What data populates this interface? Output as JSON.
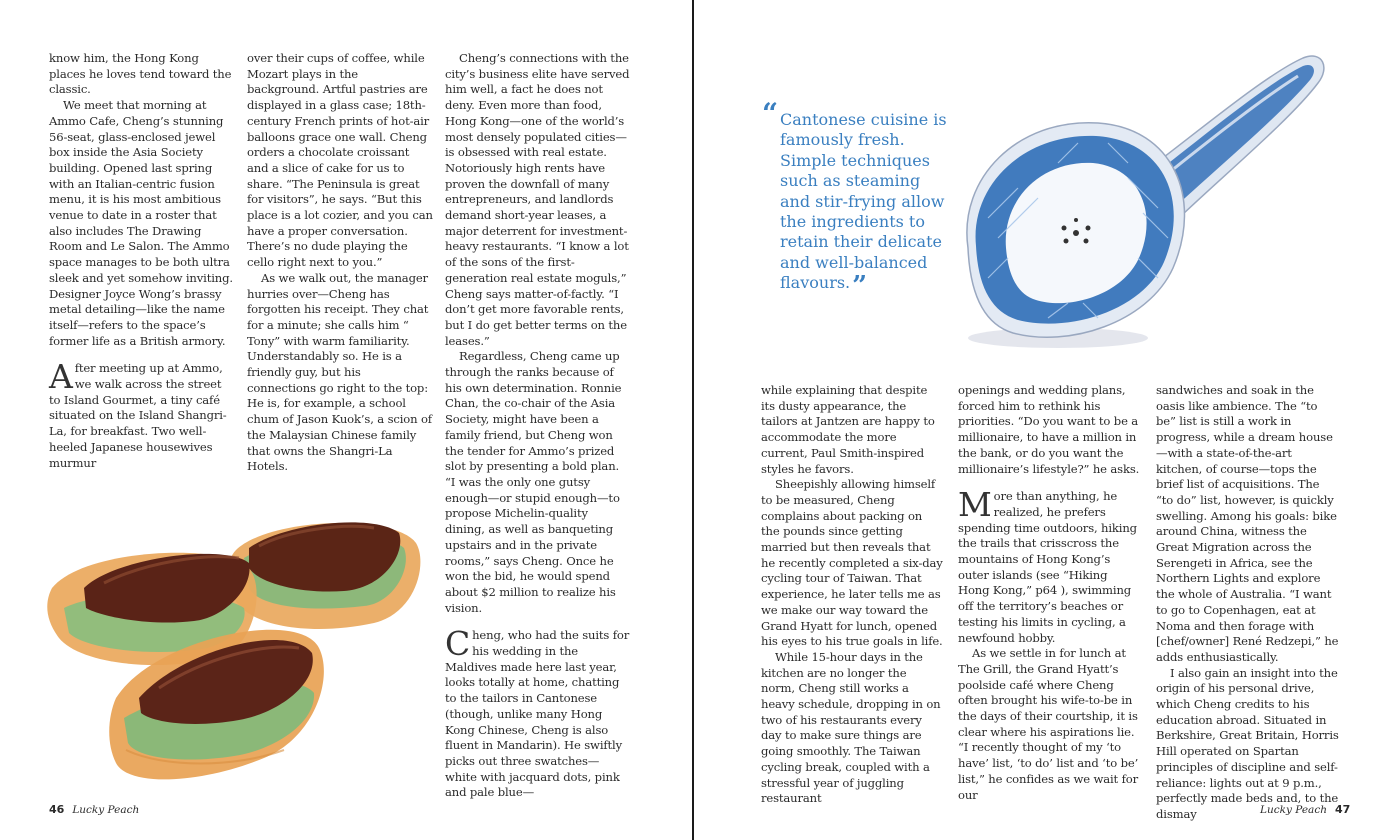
{
  "left_page": {
    "col1": {
      "p1": "know him, the Hong Kong places he loves tend toward the classic.",
      "p2": "We meet that morning at Ammo Cafe, Cheng’s stunning 56-seat, glass-enclosed jewel box inside the Asia Society building. Opened last spring with an Italian-centric fusion menu, it is his most ambitious venue to date in a roster that also includes The Drawing Room and Le Salon. The Ammo space manages to be both ultra sleek and yet somehow inviting. Designer Joyce Wong’s brassy metal detailing—like the name itself—refers to the space’s former life as a British armory.",
      "p3_drop": "A",
      "p3": "fter meeting up at Ammo, we walk across the street to Island Gourmet, a tiny café situated on the Island Shangri-La, for breakfast. Two well-heeled Japanese housewives murmur"
    },
    "col2": {
      "p1": "over their cups of coffee, while Mozart plays in the background. Artful pastries are displayed in a glass case; 18th-century French prints of hot-air balloons grace one wall. Cheng orders a chocolate croissant and a slice of cake for us to share. “The Peninsula is great for visitors”, he says. “But this place is a lot cozier, and you can have a proper conversation. There’s no dude playing the cello right next to you.”",
      "p2": "As we walk out, the manager hurries over—Cheng has forgotten his receipt. They chat for a minute; she calls him “ Tony” with warm familiarity. Understandably so. He is a friendly guy, but his connections go right to the top: He is, for example, a school chum of Jason Kuok’s, a scion of the Malaysian Chinese family that owns the Shangri-La Hotels."
    },
    "col3": {
      "p1": "Cheng’s connections with the city’s business elite have served him well, a fact he does not deny. Even more than food, Hong Kong—one of the world’s most densely populated cities—is obsessed with real estate. Notoriously high rents have proven the downfall of many entrepreneurs, and landlords demand short-year leases, a major deterrent for investment-heavy restaurants. “I know a lot of the sons of the first-generation real estate moguls,” Cheng says matter-of-factly. “I don’t get more favorable rents, but I do get better terms on the leases.”",
      "p2": "Regardless, Cheng came up through the ranks because of his own determination. Ronnie Chan, the co-chair of the Asia Society, might have been a family friend, but Cheng won the tender for Ammo’s prized slot by presenting a bold plan. “I was the only one gutsy enough—or stupid enough—to propose Michelin-quality dining, as well as banqueting upstairs and in the private rooms,” says Cheng. Once he won the bid, he would spend about $2 million to realize his vision.",
      "p3_drop": "C",
      "p3": "heng, who had the suits for his wedding in the Maldives made here last year, looks totally at home, chatting to the tailors in Cantonese (though, unlike many Hong Kong Chinese, Cheng is also fluent in Mandarin). He swiftly picks out three swatches—white with jacquard dots, pink and pale blue—"
    },
    "folio": {
      "number": "46",
      "magazine": "Lucky Peach"
    }
  },
  "right_page": {
    "pull_quote": {
      "open_mark": "“",
      "text": "Cantonese cuisine is famously fresh. Simple techniques such as steaming and stir-frying allow the ingredients to retain their delicate and well-balanced flavours.",
      "close_mark": "”"
    },
    "col1": {
      "p1": "while explaining that despite its dusty appearance, the tailors at Jantzen are happy to accommodate the more current, Paul Smith-inspired styles he favors.",
      "p2": "Sheepishly allowing himself to be measured, Cheng complains about packing on the pounds since getting married but then reveals that he recently completed a six-day cycling tour of Taiwan. That experience, he later tells me as we make our way toward the Grand Hyatt for lunch, opened his eyes to his true goals in life.",
      "p3": "While 15-hour days in the kitchen are no longer the norm, Cheng still works a heavy schedule, dropping in on two of his restaurants every day to make sure things are going smoothly. The Taiwan cycling break, coupled with a stressful year of juggling restaurant"
    },
    "col2": {
      "p1": "openings and wedding plans, forced him to rethink his priorities. “Do you want to be a millionaire, to have a million in the bank, or do you want the millionaire’s lifestyle?” he asks.",
      "p2_drop": "M",
      "p2": "ore than anything, he realized, he prefers spending time outdoors, hiking the trails that crisscross the mountains of Hong Kong’s outer islands (see “Hiking Hong Kong,” p64 ), swimming off the territory’s beaches or testing his limits in cycling, a newfound hobby.",
      "p3": "As we settle in for lunch at The Grill, the Grand Hyatt’s poolside café where Cheng often brought his wife-to-be in the days of their courtship, it is clear where his aspirations lie. “I recently thought of my ‘to have’ list, ‘to do’ list and ‘to be’ list,” he confides as we wait for our"
    },
    "col3": {
      "p1": "sandwiches and soak in the oasis like ambience. The “to be” list is still a work in progress, while a dream house—with a state-of-the-art kitchen, of course—tops the brief list of acquisitions. The “to do” list, however, is quickly swelling. Among his goals: bike around China, witness the Great Migration across the Serengeti in Africa, see the Northern Lights and explore the whole of Australia. “I want to go to Copenhagen, eat at Noma and then forage with [chef/owner] René Redzepi,” he adds enthusiastically.",
      "p2": "I also gain an insight into the origin of his personal drive, which Cheng credits to his education abroad. Situated in Berkshire, Great Britain, Horris Hill operated on Spartan principles of discipline and self-reliance: lights out at 9 p.m., perfectly made beds and, to the dismay"
    },
    "folio": {
      "number": "47",
      "magazine": "Lucky Peach"
    }
  },
  "colors": {
    "pull_quote": "#3a7fc0",
    "spoon_blue": "#2f6fb8",
    "meat": "#5a2418",
    "bun": "#e8a85a",
    "greens": "#7cb87a"
  }
}
